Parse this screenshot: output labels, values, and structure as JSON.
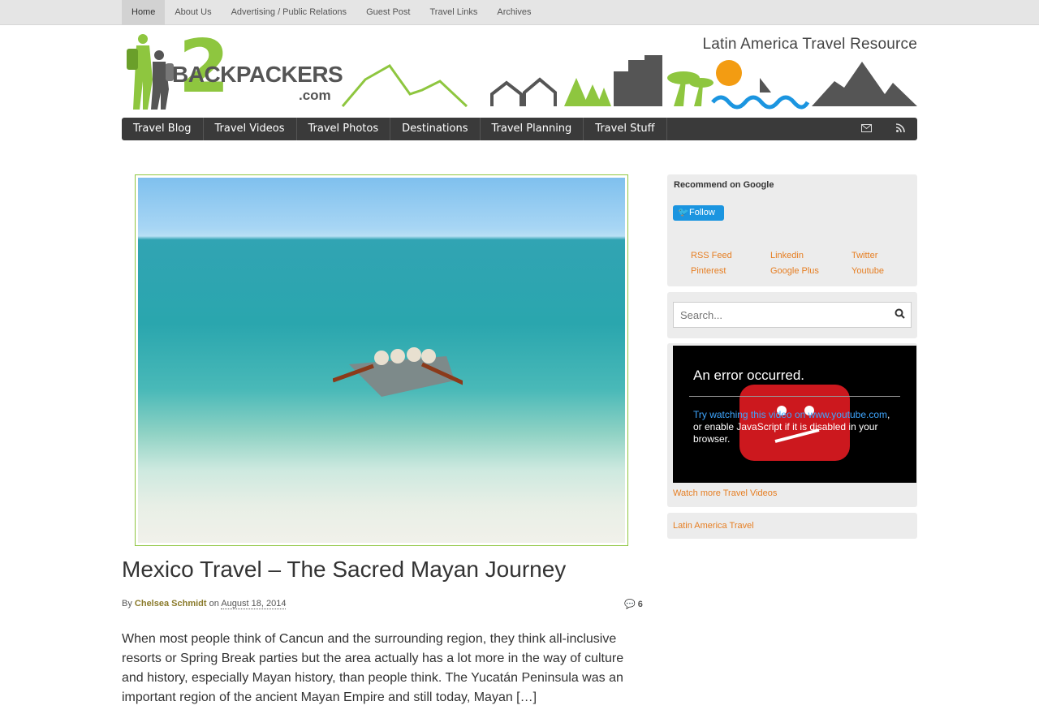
{
  "topnav": {
    "items": [
      "Home",
      "About Us",
      "Advertising / Public Relations",
      "Guest Post",
      "Travel Links",
      "Archives"
    ]
  },
  "header": {
    "logo_two": "2",
    "logo_name": "BACKPACKERS",
    "logo_domain": ".com",
    "tagline": "Latin America Travel Resource",
    "accent_green": "#8ec63f",
    "accent_blue": "#1b95e0",
    "accent_dark": "#555555"
  },
  "mainnav": {
    "items": [
      "Travel Blog",
      "Travel Videos",
      "Travel Photos",
      "Destinations",
      "Travel Planning",
      "Travel Stuff"
    ],
    "icons": [
      "envelope-icon",
      "rss-icon"
    ]
  },
  "article": {
    "title": "Mexico Travel – The Sacred Mayan Journey",
    "by": "By",
    "author": "Chelsea Schmidt",
    "on": "on",
    "date": "August 18, 2014",
    "comment_count": "6",
    "excerpt": "When most people think of Cancun and the surrounding region, they think all-inclusive resorts or Spring Break parties but the area actually has a lot more in the way of culture and history, especially Mayan history, than people think. The Yucatán Peninsula was an important region of the ancient Mayan Empire and still today, Mayan […]"
  },
  "sidebar": {
    "recommend_title": "Recommend on Google",
    "follow_label": "Follow",
    "social": [
      "RSS Feed",
      "Linkedin",
      "Twitter",
      "Pinterest",
      "Google Plus",
      "Youtube"
    ],
    "search_placeholder": "Search...",
    "video": {
      "error_title": "An error occurred.",
      "msg_link": "Try watching this video on www.youtube.com",
      "msg_rest": ", or enable JavaScript if it is disabled in your browser."
    },
    "watch_more": "Watch more Travel Videos",
    "latin_link": "Latin America Travel",
    "link_color": "#e67e22"
  }
}
